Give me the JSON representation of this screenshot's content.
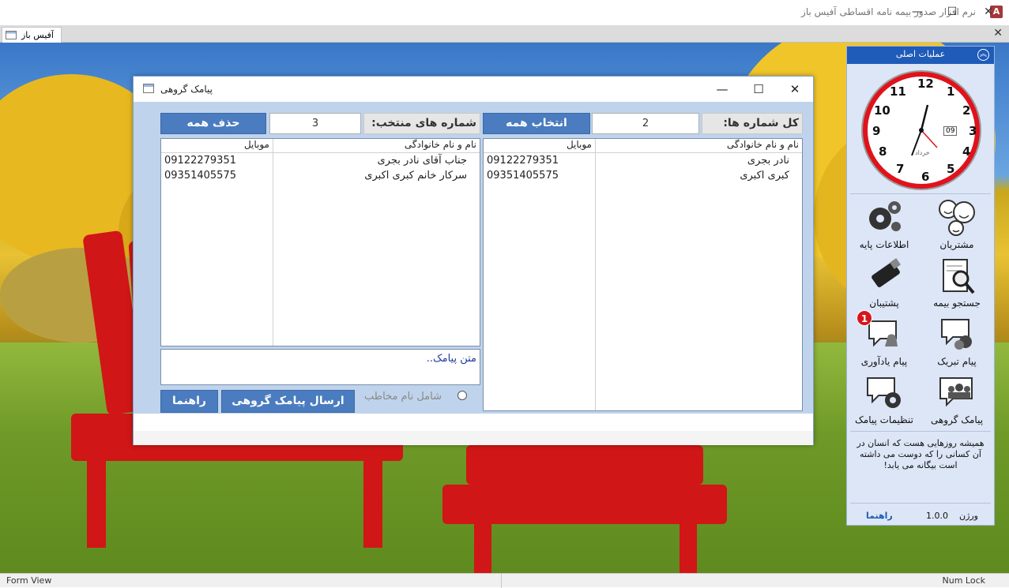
{
  "app": {
    "title": "نرم افزار صدور بیمه نامه اقساطی آفیس باز",
    "icon": "access-app-icon"
  },
  "doc_tab": {
    "label": "آفیس باز"
  },
  "status": {
    "left": "Form View",
    "right": "Num Lock"
  },
  "dialog": {
    "title": "پیامک گروهی",
    "total_label": "کل شماره ها:",
    "total_value": "2",
    "select_all": "انتخاب همه",
    "selected_label": "شماره های منتخب:",
    "selected_value": "3",
    "delete_all": "حذف همه",
    "left_list": {
      "headers": {
        "name": "نام و نام خانوادگی",
        "mobile": "موبایل"
      },
      "rows": [
        {
          "name": "نادر بجری",
          "mobile": "09122279351"
        },
        {
          "name": "کبری اکبری",
          "mobile": "09351405575"
        }
      ]
    },
    "right_list": {
      "headers": {
        "name": "نام و نام خانوادگی",
        "mobile": "موبایل"
      },
      "rows": [
        {
          "name": "جناب آقای  نادر بجری",
          "mobile": "09122279351"
        },
        {
          "name": "سرکار خانم کبری اکبری",
          "mobile": "09351405575"
        }
      ]
    },
    "message_placeholder": "متن پیامک..",
    "include_name_label": "شامل نام مخاطب",
    "send_button": "ارسال پیامک گروهی",
    "help_button": "راهنما"
  },
  "panel": {
    "title": "عملیات اصلی",
    "clock": {
      "day": "09",
      "month": "خرداد"
    },
    "items": [
      {
        "label": "مشتریان",
        "icon": "customers-icon"
      },
      {
        "label": "اطلاعات پایه",
        "icon": "gears-icon"
      },
      {
        "label": "جستجو بیمه",
        "icon": "search-document-icon"
      },
      {
        "label": "پشتیبان",
        "icon": "usb-icon"
      },
      {
        "label": "پیام تبریک",
        "icon": "greeting-message-icon"
      },
      {
        "label": "پیام یادآوری",
        "icon": "reminder-message-icon"
      },
      {
        "label": "پیامک گروهی",
        "icon": "group-sms-icon"
      },
      {
        "label": "تنظیمات پیامک",
        "icon": "sms-settings-icon"
      }
    ],
    "reminder_badge": "1",
    "quote": "همیشه روزهایی هست که انسان در آن کسانی را که دوست می داشته است بیگانه می یابد!",
    "version_label": "ورژن",
    "version_value": "1.0.0",
    "help_link": "راهنما"
  },
  "colors": {
    "accent": "#4a7cbf",
    "panel_head": "#1f5bb8",
    "clock_ring": "#e0121b",
    "badge": "#d8151c"
  }
}
